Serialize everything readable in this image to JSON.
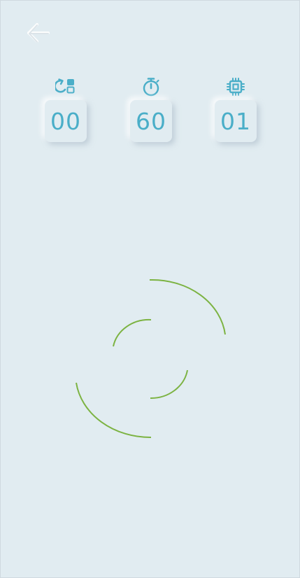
{
  "screen": {
    "background_color": "#e1ecf1"
  },
  "back_button": {
    "icon": "arrow-left-icon"
  },
  "stats": [
    {
      "icon": "rounds-icon",
      "value": "00"
    },
    {
      "icon": "stopwatch-icon",
      "value": "60"
    },
    {
      "icon": "cpu-icon",
      "value": "01"
    }
  ],
  "loading_spinner": {
    "icon": "spinner-icon",
    "color": "#7cb342"
  },
  "colors": {
    "accent": "#4aaec8",
    "spinner": "#7cb342"
  }
}
